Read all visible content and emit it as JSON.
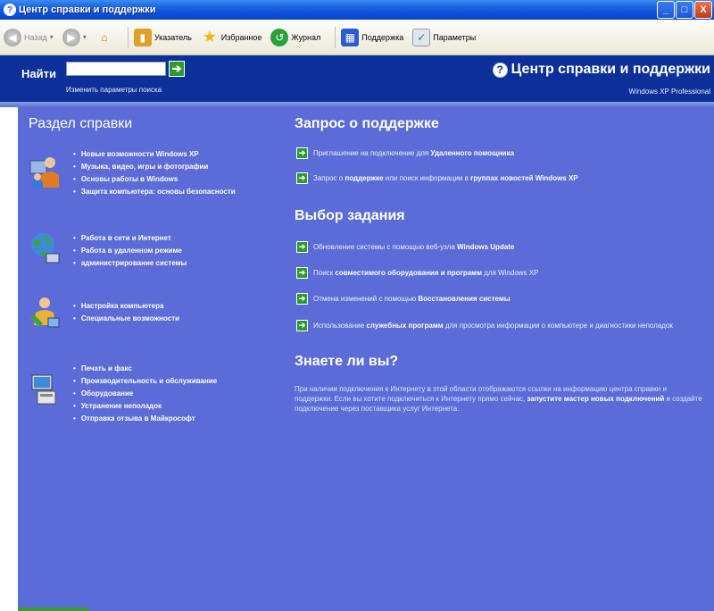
{
  "window": {
    "title": "Центр справки и поддержки",
    "controls": [
      "_",
      "□",
      "X"
    ]
  },
  "toolbar": {
    "back": "Назад",
    "index": "Указатель",
    "favorites": "Избранное",
    "history": "Журнал",
    "support": "Поддержка",
    "options": "Параметры"
  },
  "header": {
    "find_label": "Найти",
    "search_value": "",
    "search_options": "Изменить параметры поиска",
    "center_title": "Центр справки и поддержки",
    "edition": "Windows XP Professional"
  },
  "help_section": {
    "title": "Раздел справки",
    "groups": [
      {
        "icon": "people-icon",
        "items": [
          "Новые возможности Windows XP",
          "Музыка, видео, игры и фотографии",
          "Основы работы в Windows",
          "Защита компьютера: основы безопасности"
        ]
      },
      {
        "icon": "globe-network-icon",
        "items": [
          "Работа в сети и Интернет",
          "Работа в удаленном режиме",
          "администрирование системы"
        ]
      },
      {
        "icon": "person-tools-icon",
        "items": [
          "Настройка компьютера",
          "Специальные возможности"
        ]
      },
      {
        "icon": "computer-printer-icon",
        "items": [
          "Печать и факс",
          "Производительность и обслуживание",
          "Оборудование",
          "Устранение неполадок",
          "Отправка отзыва в Майкрософт"
        ]
      }
    ]
  },
  "support_request": {
    "title": "Запрос о поддержке",
    "items": [
      {
        "pre": "Приглашение на подключение для ",
        "bold": "Удаленного помощника",
        "post": ""
      },
      {
        "pre": "Запрос о ",
        "bold": "поддержке",
        "post": " или поиск информации в ",
        "bold2": "группах новостей Windows XP"
      }
    ]
  },
  "tasks": {
    "title": "Выбор задания",
    "items": [
      {
        "pre": "Обновление системы с помощью веб-узла ",
        "bold": "Windows Update",
        "post": ""
      },
      {
        "pre": "Поиск ",
        "bold": "совместимого оборудования и программ",
        "post": " для Windows XP"
      },
      {
        "pre": "Отмена изменений с помощью ",
        "bold": "Восстановления системы",
        "post": ""
      },
      {
        "pre": "Использование ",
        "bold": "служебных программ",
        "post": " для просмотра информации о компьютере и диагностики неполадок"
      }
    ]
  },
  "did_you_know": {
    "title": "Знаете ли вы?",
    "text_pre": "При наличии подключения к Интернету в этой области отображаются ссылки на информацию центра справки и поддержки. Если вы хотите подключиться к Интернету прямо сейчас, ",
    "text_bold": "запустите мастер новых подключений",
    "text_post": " и создайте подключение через поставщика услуг Интернета."
  }
}
